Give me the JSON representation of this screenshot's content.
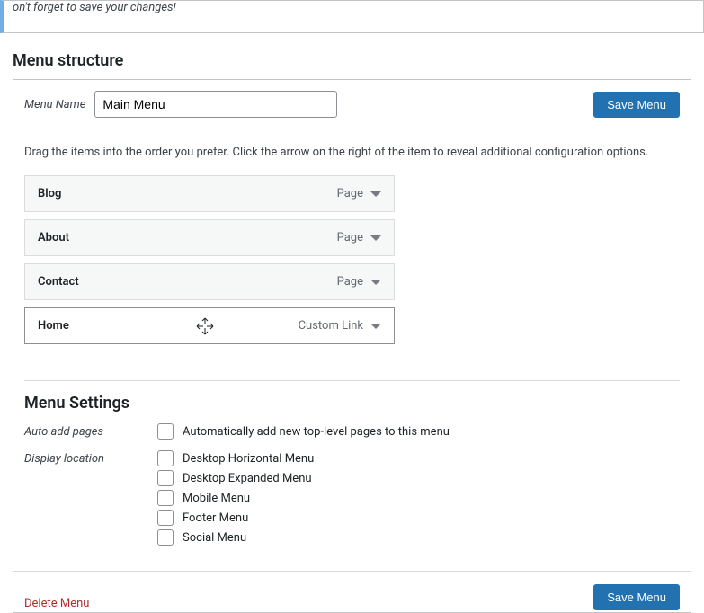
{
  "notice_text": "on't forget to save your changes!",
  "heading_structure": "Menu structure",
  "menu_name_label": "Menu Name",
  "menu_name_value": "Main Menu",
  "save_button": "Save Menu",
  "instructions": "Drag the items into the order you prefer. Click the arrow on the right of the item to reveal additional configuration options.",
  "menu_items": [
    {
      "title": "Blog",
      "type": "Page"
    },
    {
      "title": "About",
      "type": "Page"
    },
    {
      "title": "Contact",
      "type": "Page"
    },
    {
      "title": "Home",
      "type": "Custom Link"
    }
  ],
  "heading_settings": "Menu Settings",
  "settings": {
    "auto_add_label": "Auto add pages",
    "auto_add_option": "Automatically add new top-level pages to this menu",
    "display_location_label": "Display location",
    "display_locations": [
      "Desktop Horizontal Menu",
      "Desktop Expanded Menu",
      "Mobile Menu",
      "Footer Menu",
      "Social Menu"
    ]
  },
  "delete_link": "Delete Menu",
  "save_button_bottom": "Save Menu"
}
